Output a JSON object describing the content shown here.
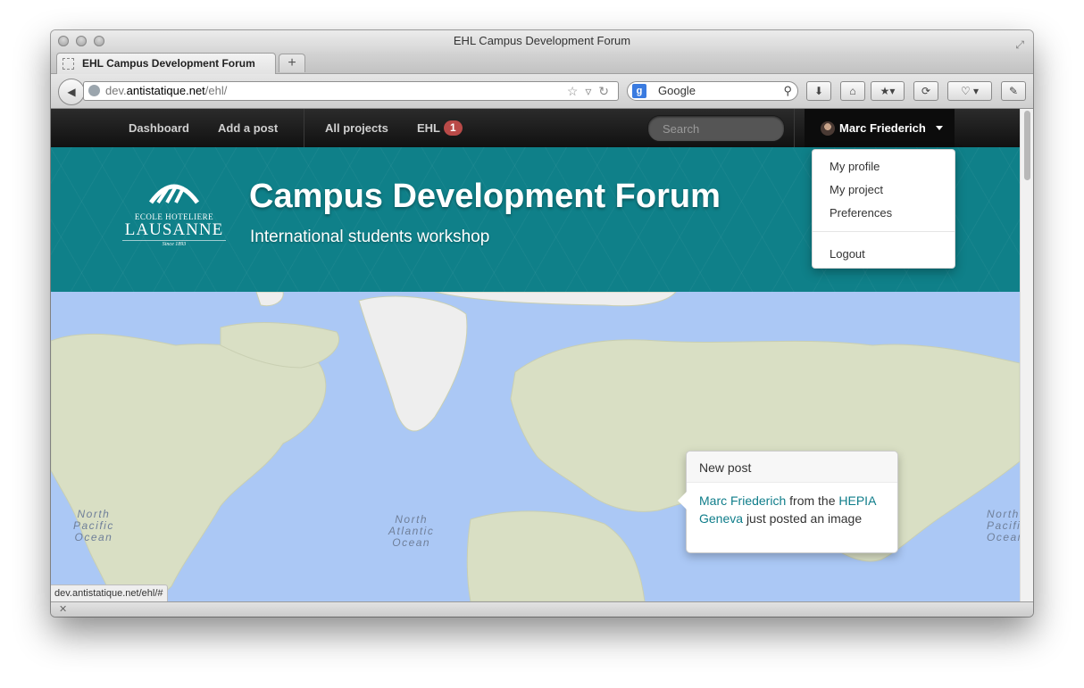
{
  "window": {
    "title": "EHL Campus Development Forum"
  },
  "tabs": [
    {
      "label": "EHL Campus Development Forum"
    }
  ],
  "newtab": {
    "label": "+"
  },
  "urlbar": {
    "prefix": "dev.",
    "host": "antistatique.net",
    "path": "/ehl/"
  },
  "browser_search": {
    "engine_label": "Google",
    "engine_icon": "g"
  },
  "site_nav": {
    "links": [
      {
        "label": "Dashboard"
      },
      {
        "label": "Add a post"
      },
      {
        "label": "All projects"
      },
      {
        "label": "EHL",
        "badge": "1"
      }
    ],
    "search_placeholder": "Search",
    "user": {
      "name": "Marc Friederich"
    }
  },
  "user_dropdown": {
    "items": [
      {
        "label": "My profile"
      },
      {
        "label": "My project"
      },
      {
        "label": "Preferences"
      },
      {
        "label": "Logout"
      }
    ]
  },
  "logo": {
    "school": "ECOLE HOTELIERE",
    "name": "LAUSANNE",
    "since": "Since 1893"
  },
  "hero": {
    "title": "Campus Development Forum",
    "subtitle": "International students workshop",
    "color": "#0f8089"
  },
  "map": {
    "ocean_labels": [
      {
        "line1": "North",
        "line2": "Pacific",
        "line3": "Ocean"
      },
      {
        "line1": "North",
        "line2": "Atlantic",
        "line3": "Ocean"
      },
      {
        "line1": "North",
        "line2": "Pacific",
        "line3": "Ocean"
      }
    ]
  },
  "popover": {
    "title": "New post",
    "author": "Marc Friederich",
    "text_from": "from the",
    "org": "HEPIA Geneva",
    "text_rest": "just posted an image"
  },
  "status_url": "dev.antistatique.net/ehl/#",
  "colors": {
    "accent": "#0f7d8a",
    "badge": "#b94a48",
    "navbar": "#1b1b1b"
  }
}
